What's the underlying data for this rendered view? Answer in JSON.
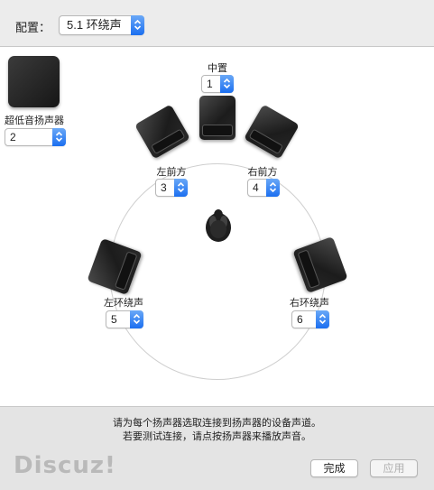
{
  "config": {
    "label": "配置：",
    "value": "5.1 环绕声"
  },
  "speakers": {
    "center": {
      "label": "中置",
      "channel": "1"
    },
    "front_left": {
      "label": "左前方",
      "channel": "3"
    },
    "front_right": {
      "label": "右前方",
      "channel": "4"
    },
    "surround_left": {
      "label": "左环绕声",
      "channel": "5"
    },
    "surround_right": {
      "label": "右环绕声",
      "channel": "6"
    },
    "subwoofer": {
      "label": "超低音扬声器",
      "channel": "2"
    }
  },
  "hint": {
    "line1": "请为每个扬声器选取连接到扬声器的设备声道。",
    "line2": "若要测试连接，请点按扬声器来播放声音。"
  },
  "buttons": {
    "done": "完成",
    "apply": "应用"
  },
  "watermark": "Discuz!",
  "colors": {
    "accent": "#1b6ff0",
    "speaker": "#1c1c1c",
    "circle": "#cfcfcf"
  },
  "icons": {
    "popup_arrows": "up-down-chevron-icon",
    "listener": "listener-head-icon"
  }
}
